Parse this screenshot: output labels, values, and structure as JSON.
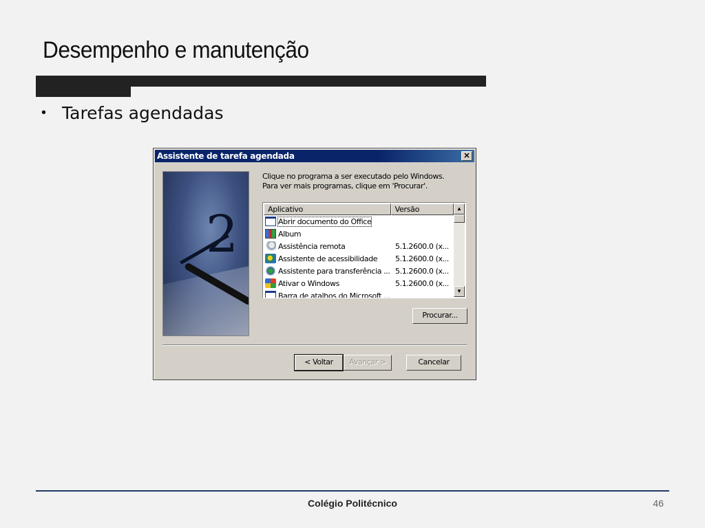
{
  "slide": {
    "title": "Desempenho e manutenção",
    "bullet": "Tarefas agendadas",
    "footer_text": "Colégio Politécnico",
    "page_number": "46"
  },
  "dialog": {
    "title": "Assistente de tarefa agendada",
    "close_symbol": "✕",
    "instructions_line1": "Clique no programa a ser executado pelo Windows.",
    "instructions_line2": "Para ver mais programas, clique em 'Procurar'.",
    "columns": {
      "app": "Aplicativo",
      "version": "Versão"
    },
    "rows": [
      {
        "name": "Abrir documento do Office",
        "version": "",
        "icon": "office-document-icon"
      },
      {
        "name": "Album",
        "version": "",
        "icon": "album-icon"
      },
      {
        "name": "Assistência remota",
        "version": "5.1.2600.0 (x...",
        "icon": "remote-assistance-icon"
      },
      {
        "name": "Assistente de acessibilidade",
        "version": "5.1.2600.0 (x...",
        "icon": "accessibility-icon"
      },
      {
        "name": "Assistente para transferência ...",
        "version": "5.1.2600.0 (x...",
        "icon": "transfer-wizard-icon"
      },
      {
        "name": "Ativar o Windows",
        "version": "5.1.2600.0 (x...",
        "icon": "activate-windows-icon"
      },
      {
        "name": "Barra de atalhos do Microsoft ...",
        "version": "",
        "icon": "shortcut-bar-icon"
      }
    ],
    "buttons": {
      "browse": "Procurar...",
      "back": "< Voltar",
      "next": "Avançar >",
      "cancel": "Cancelar"
    }
  },
  "colors": {
    "titlebar": "#0a246a",
    "dialog_bg": "#d4d0c8",
    "footer_line": "#1f3864"
  }
}
